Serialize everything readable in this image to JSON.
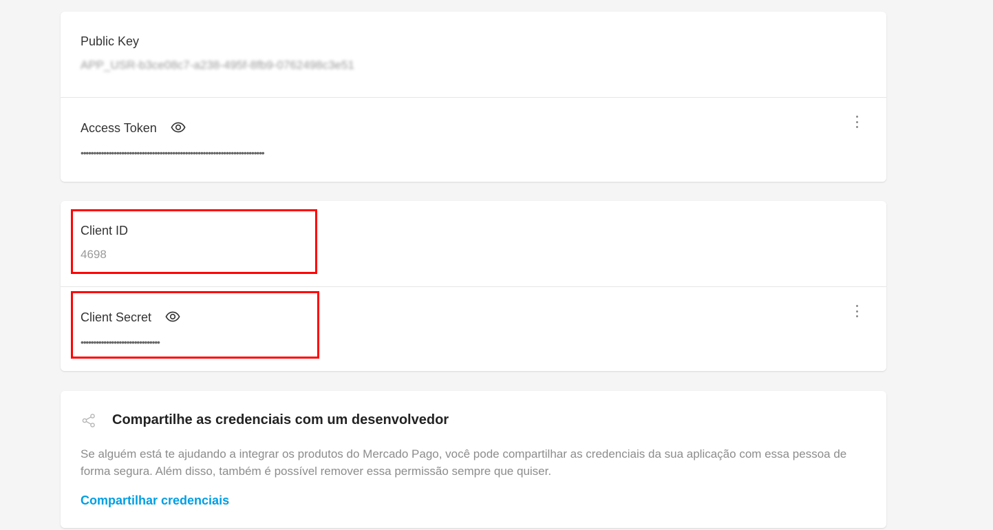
{
  "production_credentials": {
    "public_key": {
      "label": "Public Key",
      "value": "APP_USR-b3ce08c7-a238-495f-8fb9-0762498c3e51"
    },
    "access_token": {
      "label": "Access Token",
      "value": "••••••••••••••••••••••••••••••••••••••••••••••••••••••••••••••••••••••••"
    }
  },
  "oauth_credentials": {
    "client_id": {
      "label": "Client ID",
      "value": "4698"
    },
    "client_secret": {
      "label": "Client Secret",
      "value": "•••••••••••••••••••••••••••••••"
    }
  },
  "share": {
    "title": "Compartilhe as credenciais com um desenvolvedor",
    "description": "Se alguém está te ajudando a integrar os produtos do Mercado Pago, você pode compartilhar as credenciais da sua aplicação com essa pessoa de forma segura. Além disso, também é possível remover essa permissão sempre que quiser.",
    "link_label": "Compartilhar credenciais"
  },
  "icons": {
    "reveal": "eye-icon",
    "more": "kebab-menu-icon",
    "share": "share-icon"
  },
  "colors": {
    "highlight": "#ff0000",
    "link": "#009ee3",
    "background": "#f5f5f5"
  }
}
